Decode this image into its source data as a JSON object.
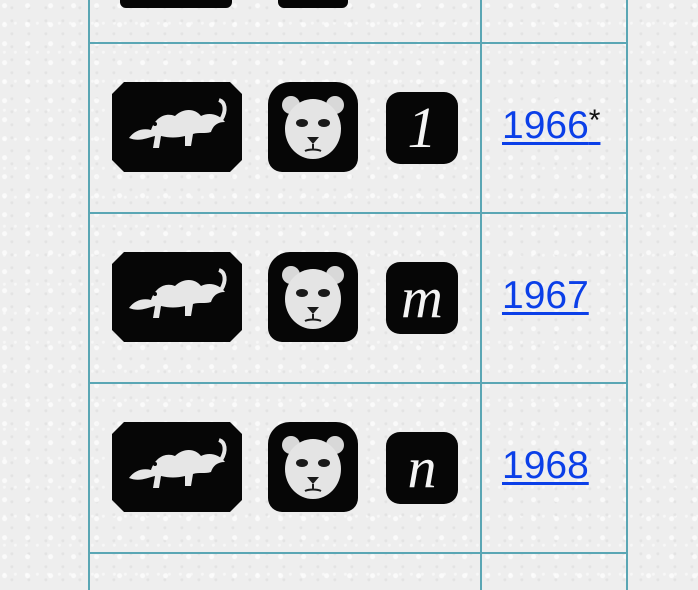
{
  "rows": [
    {
      "letter": "1",
      "year": "1966",
      "note": "*"
    },
    {
      "letter": "m",
      "year": "1967",
      "note": ""
    },
    {
      "letter": "n",
      "year": "1968",
      "note": ""
    }
  ],
  "icons": [
    "lion-passant-icon",
    "leopard-head-icon",
    "date-letter-icon"
  ],
  "colors": {
    "grid": "#5aa6b4",
    "link": "#0b3fe8",
    "mark": "#060606",
    "background": "#eeeeee"
  }
}
